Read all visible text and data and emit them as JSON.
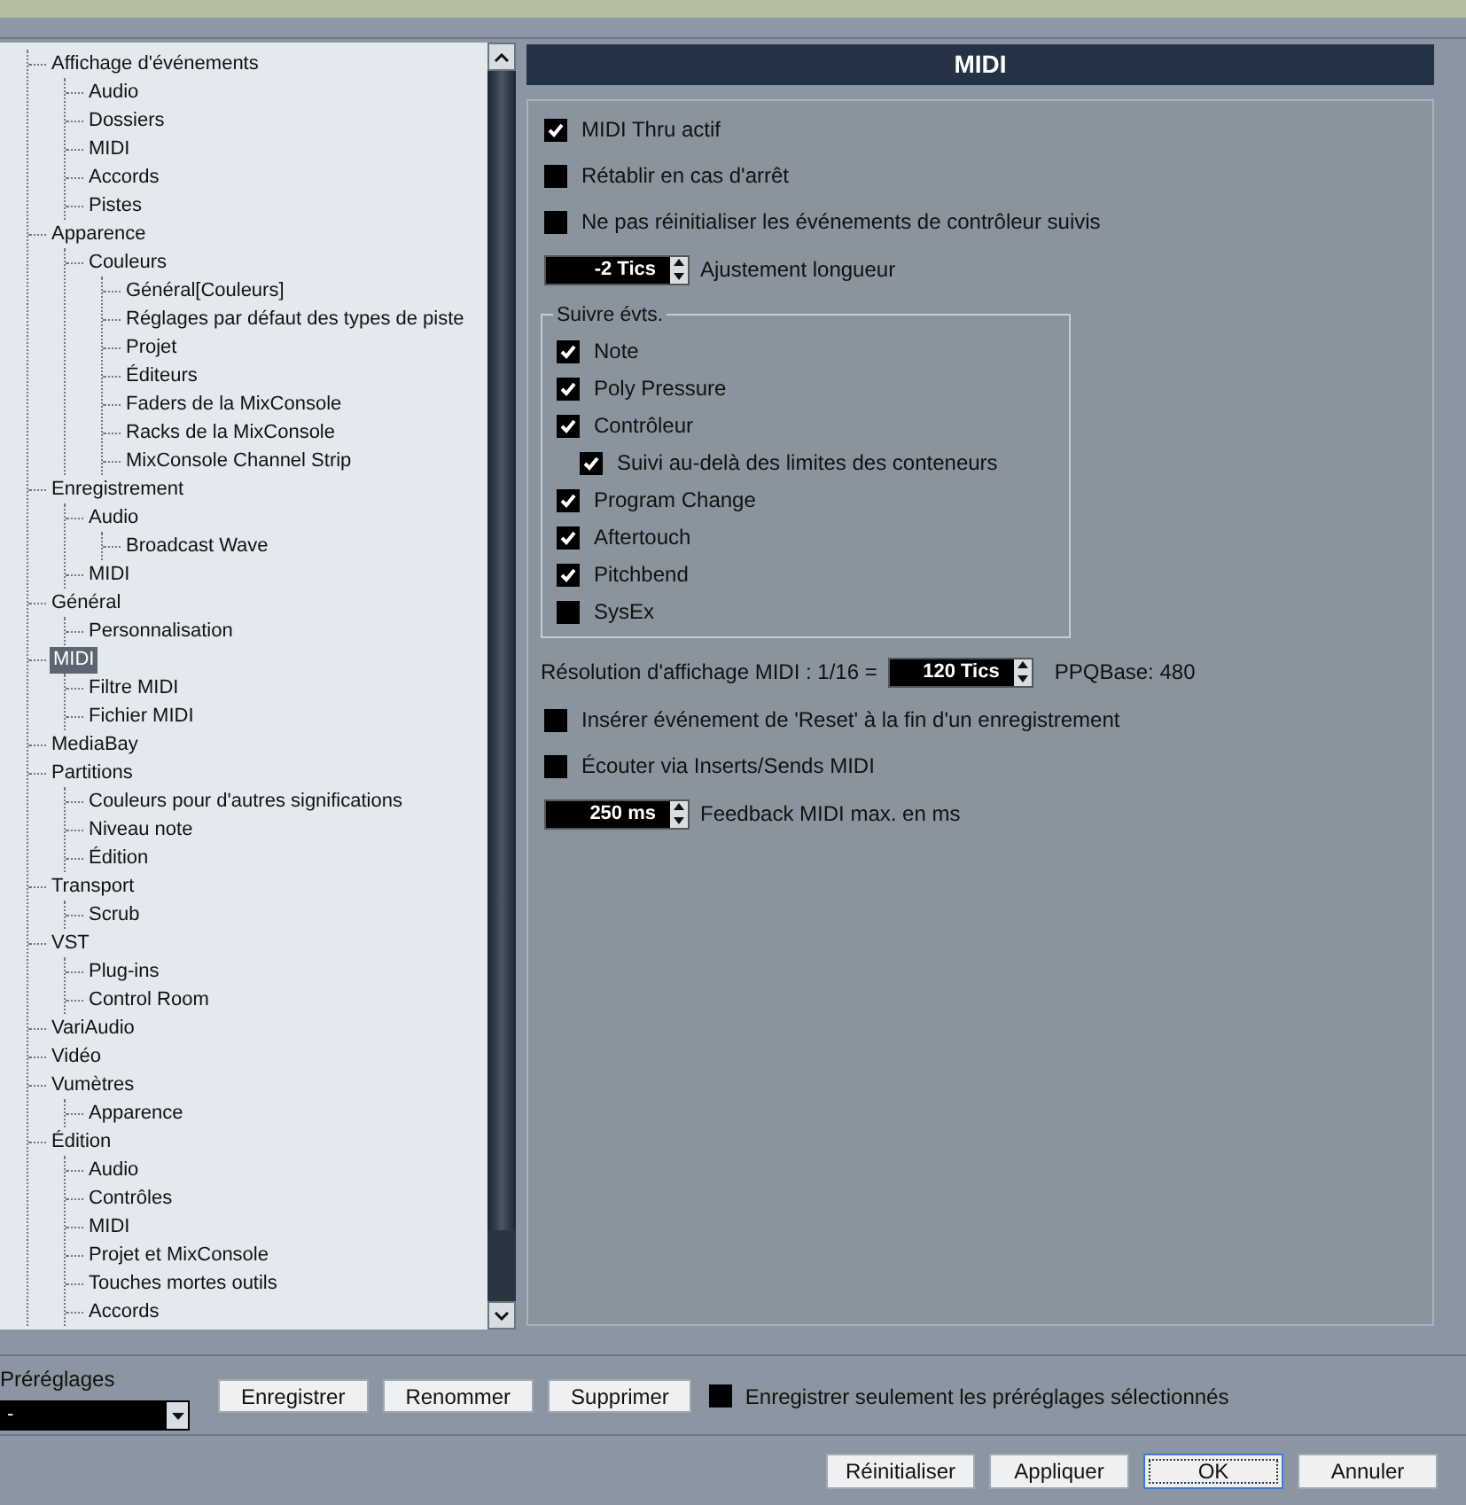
{
  "tree": {
    "items": [
      {
        "label": "Affichage d'événements",
        "selected": false,
        "children": [
          {
            "label": "Audio",
            "selected": false
          },
          {
            "label": "Dossiers",
            "selected": false
          },
          {
            "label": "MIDI",
            "selected": false
          },
          {
            "label": "Accords",
            "selected": false
          },
          {
            "label": "Pistes",
            "selected": false
          }
        ]
      },
      {
        "label": "Apparence",
        "selected": false,
        "children": [
          {
            "label": "Couleurs",
            "selected": false,
            "children": [
              {
                "label": "Général[Couleurs]",
                "selected": false
              },
              {
                "label": "Réglages par défaut des types de piste",
                "selected": false
              },
              {
                "label": "Projet",
                "selected": false
              },
              {
                "label": "Éditeurs",
                "selected": false
              },
              {
                "label": "Faders de la MixConsole",
                "selected": false
              },
              {
                "label": "Racks de la MixConsole",
                "selected": false
              },
              {
                "label": "MixConsole Channel Strip",
                "selected": false
              }
            ]
          }
        ]
      },
      {
        "label": "Enregistrement",
        "selected": false,
        "children": [
          {
            "label": "Audio",
            "selected": false,
            "children": [
              {
                "label": "Broadcast Wave",
                "selected": false
              }
            ]
          },
          {
            "label": "MIDI",
            "selected": false
          }
        ]
      },
      {
        "label": "Général",
        "selected": false,
        "children": [
          {
            "label": "Personnalisation",
            "selected": false
          }
        ]
      },
      {
        "label": "MIDI",
        "selected": true,
        "children": [
          {
            "label": "Filtre MIDI",
            "selected": false
          },
          {
            "label": "Fichier MIDI",
            "selected": false
          }
        ]
      },
      {
        "label": "MediaBay",
        "selected": false
      },
      {
        "label": "Partitions",
        "selected": false,
        "children": [
          {
            "label": "Couleurs pour d'autres significations",
            "selected": false
          },
          {
            "label": "Niveau note",
            "selected": false
          },
          {
            "label": "Édition",
            "selected": false
          }
        ]
      },
      {
        "label": "Transport",
        "selected": false,
        "children": [
          {
            "label": "Scrub",
            "selected": false
          }
        ]
      },
      {
        "label": "VST",
        "selected": false,
        "children": [
          {
            "label": "Plug-ins",
            "selected": false
          },
          {
            "label": "Control Room",
            "selected": false
          }
        ]
      },
      {
        "label": "VariAudio",
        "selected": false
      },
      {
        "label": "Vidéo",
        "selected": false
      },
      {
        "label": "Vumètres",
        "selected": false,
        "children": [
          {
            "label": "Apparence",
            "selected": false
          }
        ]
      },
      {
        "label": "Édition",
        "selected": false,
        "children": [
          {
            "label": "Audio",
            "selected": false
          },
          {
            "label": "Contrôles",
            "selected": false
          },
          {
            "label": "MIDI",
            "selected": false
          },
          {
            "label": "Projet et MixConsole",
            "selected": false
          },
          {
            "label": "Touches mortes outils",
            "selected": false
          },
          {
            "label": "Accords",
            "selected": false
          }
        ]
      }
    ]
  },
  "panel": {
    "title": "MIDI",
    "options": [
      {
        "kind": "checkbox",
        "label": "MIDI Thru actif",
        "checked": true
      },
      {
        "kind": "checkbox",
        "label": "Rétablir en cas d'arrêt",
        "checked": false
      },
      {
        "kind": "checkbox",
        "label": "Ne pas réinitialiser les événements de contrôleur suivis",
        "checked": false
      },
      {
        "kind": "spinbox",
        "value": "-2 Tics",
        "label": "Ajustement longueur"
      },
      {
        "kind": "group",
        "title": "Suivre évts.",
        "items": [
          {
            "label": "Note",
            "checked": true
          },
          {
            "label": "Poly Pressure",
            "checked": true
          },
          {
            "label": "Contrôleur",
            "checked": true,
            "children": [
              {
                "label": "Suivi au-delà des limites des conteneurs",
                "checked": true
              }
            ]
          },
          {
            "label": "Program Change",
            "checked": true
          },
          {
            "label": "Aftertouch",
            "checked": true
          },
          {
            "label": "Pitchbend",
            "checked": true
          },
          {
            "label": "SysEx",
            "checked": false
          }
        ]
      },
      {
        "kind": "resolution",
        "label": "Résolution d'affichage MIDI : 1/16 =",
        "value": "120 Tics",
        "note": "PPQBase: 480"
      },
      {
        "kind": "checkbox",
        "label": "Insérer événement de 'Reset' à la fin d'un enregistrement",
        "checked": false
      },
      {
        "kind": "checkbox",
        "label": "Écouter via Inserts/Sends MIDI",
        "checked": false
      },
      {
        "kind": "spinbox",
        "value": "250 ms",
        "label": "Feedback MIDI max. en ms"
      }
    ]
  },
  "presets": {
    "label": "Préréglages",
    "value": "-",
    "buttons": [
      "Enregistrer",
      "Renommer",
      "Supprimer"
    ],
    "option": {
      "label": "Enregistrer seulement les préréglages sélectionnés",
      "checked": false
    }
  },
  "buttons": [
    {
      "label": "Réinitialiser",
      "focused": false
    },
    {
      "label": "Appliquer",
      "focused": false
    },
    {
      "label": "OK",
      "focused": true
    },
    {
      "label": "Annuler",
      "focused": false
    }
  ]
}
